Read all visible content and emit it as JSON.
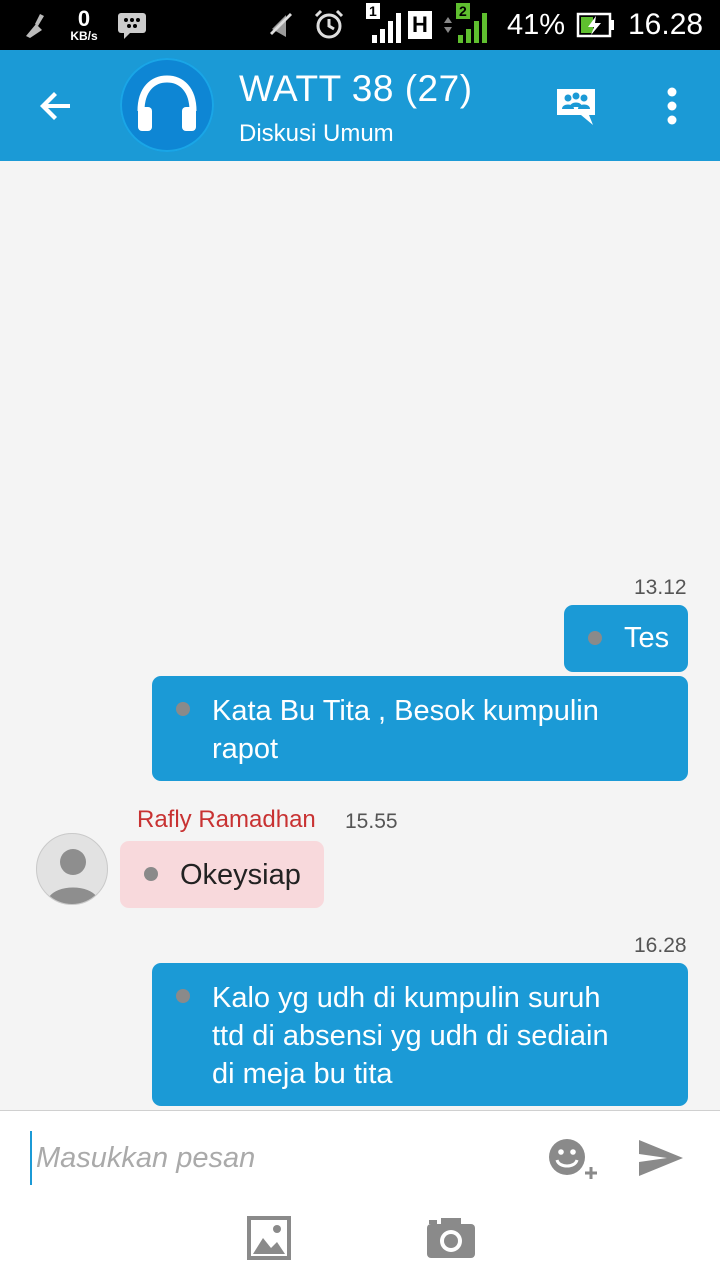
{
  "status_bar": {
    "net_speed_value": "0",
    "net_speed_unit": "KB/s",
    "sim1": "1",
    "network_type": "H",
    "sim2": "2",
    "battery": "41%",
    "clock": "16.28"
  },
  "header": {
    "title": "WATT 38 (27)",
    "subtitle": "Diskusi Umum",
    "back_icon": "arrow-left-icon",
    "group_icon": "headphones-icon",
    "members_icon": "group-chat-icon",
    "menu_icon": "more-vert-icon"
  },
  "messages": [
    {
      "time": "13.12",
      "text": "Tes",
      "direction": "out"
    },
    {
      "text": "Kata Bu Tita , Besok kumpulin\nrapot",
      "direction": "out"
    },
    {
      "sender": "Rafly Ramadhan",
      "time": "15.55",
      "text": "Okeysiap",
      "direction": "in"
    },
    {
      "time": "16.28",
      "text": "Kalo yg udh di kumpulin suruh\nttd di absensi yg udh di sediain\ndi meja bu tita",
      "direction": "out"
    }
  ],
  "composer": {
    "placeholder": "Masukkan pesan",
    "emoji_icon": "emoji-add-icon",
    "send_icon": "send-icon",
    "image_icon": "image-icon",
    "camera_icon": "camera-icon"
  },
  "colors": {
    "accent": "#1b9ad6",
    "incoming_bubble": "#f8d9dc",
    "sender_name": "#c83232",
    "chat_background": "#f4f4f4"
  }
}
